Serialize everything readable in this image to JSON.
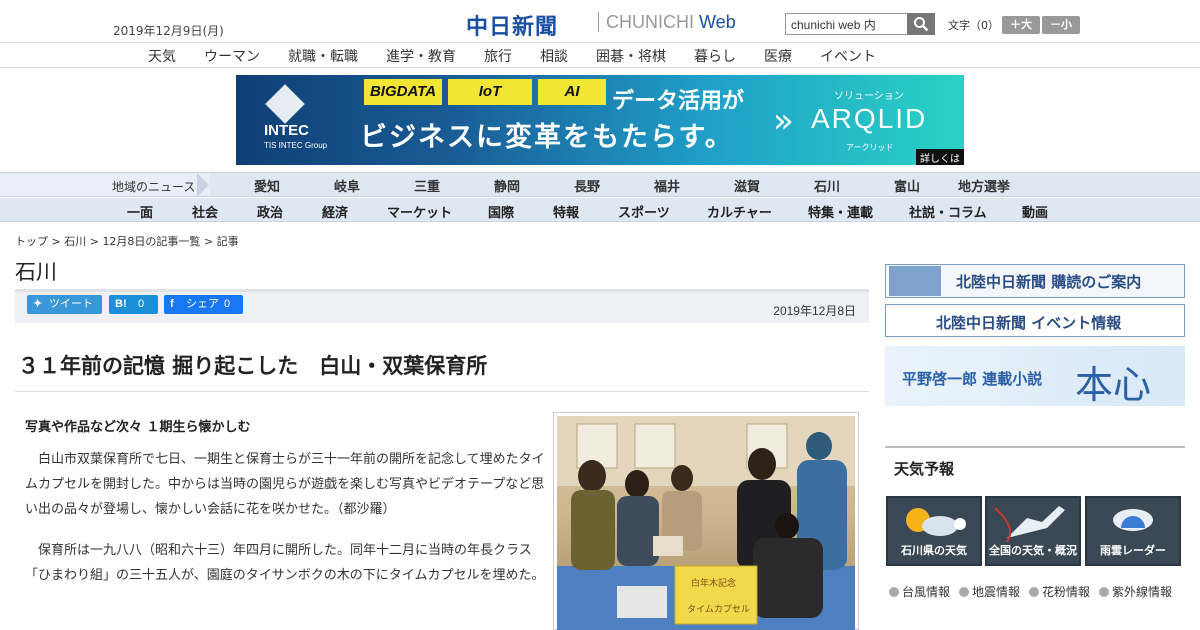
{
  "header": {
    "date": "2019年12月9日(月)",
    "logo": "中日新聞",
    "logo_sub": "CHUNICHI",
    "logo_web": "Web",
    "search_value": "chunichi web 内",
    "font_label": "文字（0）",
    "font_larger": "＋大",
    "font_smaller": "－小"
  },
  "nav1": [
    "天気",
    "ウーマン",
    "就職・転職",
    "進学・教育",
    "旅行",
    "相談",
    "囲碁・将棋",
    "暮らし",
    "医療",
    "イベント"
  ],
  "banner": {
    "tags": [
      "BIGDATA",
      "IoT",
      "AI"
    ],
    "line1": "データ活用が",
    "line2": "ビジネスに変革をもたらす。",
    "company": "INTEC",
    "company_sub": "TIS INTEC Group",
    "solution": "ソリューション",
    "product": "ARQLID",
    "product_kana": "アークリッド",
    "more": "詳しくは"
  },
  "nav2": {
    "label": "地域のニュース",
    "items": [
      "愛知",
      "岐阜",
      "三重",
      "静岡",
      "長野",
      "福井",
      "滋賀",
      "石川",
      "富山",
      "地方選挙"
    ]
  },
  "nav3": [
    "一面",
    "社会",
    "政治",
    "経済",
    "マーケット",
    "国際",
    "特報",
    "スポーツ",
    "カルチャー",
    "特集・連載",
    "社説・コラム",
    "動画"
  ],
  "breadcrumb": {
    "top": "トップ",
    "section": "石川",
    "list": "12月8日の記事一覧",
    "current": "記事",
    "sep": ">"
  },
  "section_title": "石川",
  "share": {
    "tweet": "ツイート",
    "hatena_icon": "B!",
    "hatena_count": "0",
    "fb": "シェア",
    "fb_count": "0",
    "date": "2019年12月8日"
  },
  "article": {
    "headline": "３１年前の記憶 掘り起こした　白山・双葉保育所",
    "lede": "写真や作品など次々 １期生ら懐かしむ",
    "paragraphs": [
      "白山市双葉保育所で七日、一期生と保育士らが三十一年前の開所を記念して埋めたタイムカプセルを開封した。中からは当時の園児らが遊戯を楽しむ写真やビデオテープなど思い出の品々が登場し、懐かしい会話に花を咲かせた。（都沙羅）",
      "保育所は一九八八（昭和六十三）年四月に開所した。同年十二月に当時の年長クラス「ひまわり組」の三十五人が、園庭のタイサンボクの木の下にタイムカプセルを埋めた。"
    ],
    "photo_sign": "白年木記念",
    "photo_sign2": "タイムカプセル"
  },
  "sidebar": {
    "subscribe": "北陸中日新聞 購読のご案内",
    "events": "北陸中日新聞 イベント情報",
    "novel": "平野啓一郎 連載小説",
    "novel_title": "本心",
    "weather_title": "天気予報",
    "tiles": [
      "石川県の天気",
      "全国の天気・概況",
      "雨雲レーダー"
    ],
    "links": [
      "台風情報",
      "地震情報",
      "花粉情報",
      "紫外線情報"
    ]
  },
  "colors": {
    "brand": "#1a4fa0",
    "twitter": "#3a97d8",
    "hatena": "#1b8fd8",
    "facebook": "#1877f2",
    "nav_bg": "#dfe7f2"
  }
}
